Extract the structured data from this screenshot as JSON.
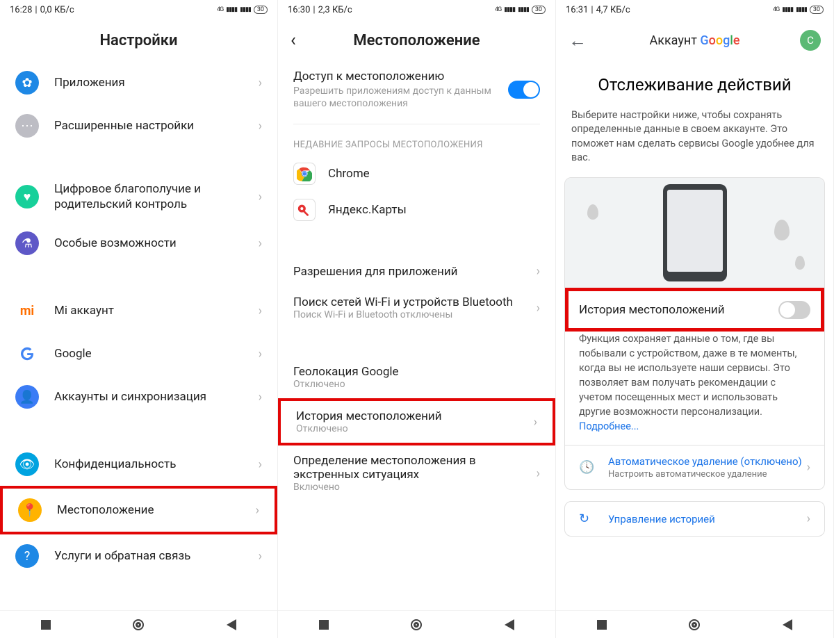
{
  "panel1": {
    "status": {
      "time": "16:28",
      "data": "0,0 КБ/с",
      "net": "4G",
      "batt": "30"
    },
    "title": "Настройки",
    "rows": {
      "apps": "Приложения",
      "advanced": "Расширенные настройки",
      "wellbeing": "Цифровое благополучие и родительский контроль",
      "accessibility": "Особые возможности",
      "mi": "Mi аккаунт",
      "google": "Google",
      "accounts": "Аккаунты и синхронизация",
      "privacy": "Конфиденциальность",
      "location": "Местоположение",
      "help": "Услуги и обратная связь"
    }
  },
  "panel2": {
    "status": {
      "time": "16:30",
      "data": "2,3 КБ/с",
      "net": "4G",
      "batt": "30"
    },
    "title": "Местоположение",
    "access": {
      "title": "Доступ к местоположению",
      "sub": "Разрешить приложениям доступ к данным вашего местоположения",
      "on": true
    },
    "recentHeader": "НЕДАВНИЕ ЗАПРОСЫ МЕСТОПОЛОЖЕНИЯ",
    "apps": {
      "chrome": "Chrome",
      "ymaps": "Яндекс.Карты"
    },
    "permissions": "Разрешения для приложений",
    "wifi": {
      "title": "Поиск сетей Wi-Fi и устройств Bluetooth",
      "sub": "Поиск Wi-Fi и Bluetooth отключены"
    },
    "geo": {
      "title": "Геолокация Google",
      "sub": "Отключено"
    },
    "history": {
      "title": "История местоположений",
      "sub": "Отключено"
    },
    "emergency": {
      "title": "Определение местоположения в экстренных ситуациях",
      "sub": "Включено"
    }
  },
  "panel3": {
    "status": {
      "time": "16:31",
      "data": "4,7 КБ/с",
      "net": "4G",
      "batt": "30"
    },
    "headerPrefix": "Аккаунт ",
    "avatar": "С",
    "pageTitle": "Отслеживание действий",
    "desc": "Выберите настройки ниже, чтобы сохранять определенные данные в своем аккаунте. Это поможет нам сделать сервисы Google удобнее для вас.",
    "toggleLabel": "История местоположений",
    "toggleOn": false,
    "para": "Функция сохраняет данные о том, где вы побывали с устройством, даже в те моменты, когда вы не используете наши сервисы. Это позволяет вам получать рекомендации с учетом посещенных мест и использовать другие возможности персонализации.",
    "more": "Подробнее...",
    "autodel": {
      "title": "Автоматическое удаление (отключено)",
      "sub": "Настроить автоматическое удаление"
    },
    "manage": "Управление историей"
  }
}
